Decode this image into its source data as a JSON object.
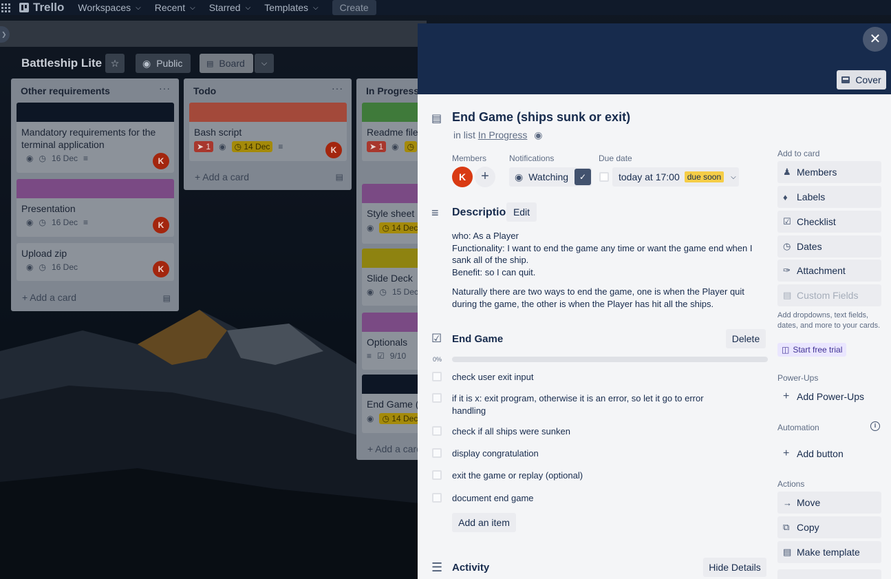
{
  "topnav": {
    "logo": "Trello",
    "items": [
      "Workspaces",
      "Recent",
      "Starred",
      "Templates"
    ],
    "create": "Create"
  },
  "board": {
    "title": "Battleship Lite",
    "visibility": "Public",
    "view": "Board"
  },
  "lists": [
    {
      "title": "Other requirements",
      "cards": [
        {
          "title": "Mandatory requirements for the terminal application",
          "due": "16 Dec",
          "cover": "#0b1a33"
        },
        {
          "title": "Presentation",
          "due": "16 Dec",
          "cover": "#8a5593"
        },
        {
          "title": "Upload zip",
          "due": "16 Dec"
        }
      ],
      "add": "Add a card"
    },
    {
      "title": "Todo",
      "cards": [
        {
          "title": "Bash script",
          "pins": "1",
          "due": "14 Dec",
          "cover": "#a84b3c"
        }
      ],
      "add": "Add a card"
    },
    {
      "title": "In Progress",
      "cards": [
        {
          "title": "Readme file",
          "pins": "1"
        },
        {
          "title": "Style sheet",
          "due": "14 Dec"
        },
        {
          "title": "Slide Deck",
          "due": "15 Dec"
        },
        {
          "title": "Optionals",
          "checklist": "9/10"
        },
        {
          "title": "End Game (s",
          "due": "14 Dec"
        }
      ],
      "add": "Add a card"
    }
  ],
  "card_detail": {
    "cover_button": "Cover",
    "title": "End Game (ships sunk or exit)",
    "in_list_prefix": "in list",
    "in_list_name": "In Progress",
    "members_label": "Members",
    "member_initial": "K",
    "notifications_label": "Notifications",
    "watching": "Watching",
    "due_label": "Due date",
    "due_value": "today at 17:00",
    "due_status": "due soon",
    "description_title": "Description",
    "edit": "Edit",
    "description_lines": [
      "who: As a Player",
      "Functionality: I want to end the game any time or want the game end when I sank all of the ship.",
      "Benefit: so I can quit."
    ],
    "description_para2": "Naturally there are two ways to end the game, one is when the Player quit during the game, the other is when the Player has hit all the ships.",
    "checklist_title": "End Game",
    "delete": "Delete",
    "progress_text": "0%",
    "progress_value": 0,
    "checklist_items": [
      "check user exit input",
      "if it is x: exit program, otherwise it is an error, so let it go to error handling",
      "check if all ships were sunken",
      "display congratulation",
      "exit the game or replay (optional)",
      "document end game"
    ],
    "add_item": "Add an item",
    "activity_title": "Activity",
    "hide_details": "Hide Details"
  },
  "sidebar": {
    "add_to_card": "Add to card",
    "buttons": [
      "Members",
      "Labels",
      "Checklist",
      "Dates",
      "Attachment"
    ],
    "custom_fields": "Custom Fields",
    "upsell": "Add dropdowns, text fields, dates, and more to your cards.",
    "trial": "Start free trial",
    "powerups_label": "Power-Ups",
    "add_powerups": "Add Power-Ups",
    "automation_label": "Automation",
    "add_button": "Add button",
    "actions_label": "Actions",
    "actions": [
      "Move",
      "Copy",
      "Make template"
    ]
  }
}
